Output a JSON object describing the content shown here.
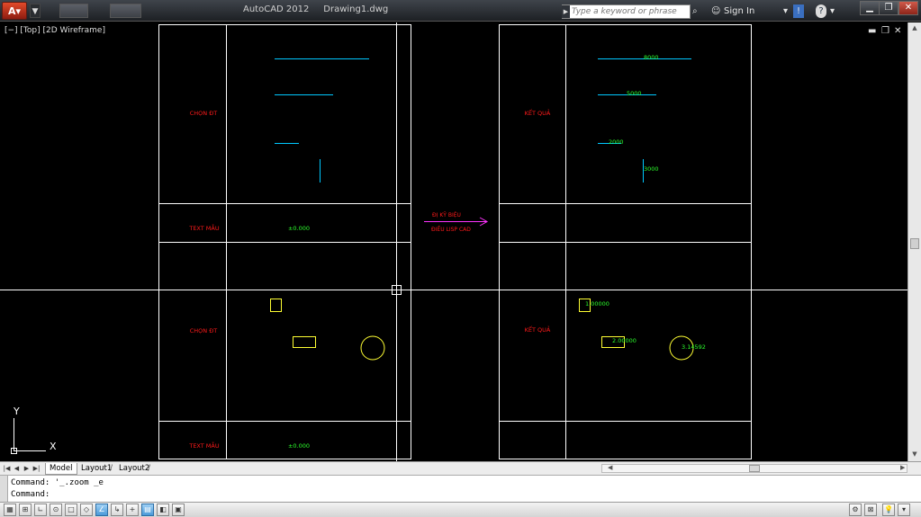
{
  "titlebar": {
    "app_name": "AutoCAD 2012",
    "document": "Drawing1.dwg",
    "search_placeholder": "Type a keyword or phrase",
    "sign_in": "Sign In"
  },
  "viewport": {
    "label": "[−] [Top] [2D Wireframe]"
  },
  "drawing": {
    "colors": {
      "frame": "#ffffff",
      "line": "#00c8ff",
      "red_text": "#ff1a1a",
      "green_text": "#2cff2c",
      "yellow_shape": "#ffff33",
      "arrow": "#ff33ff",
      "crosshair": "#ffffff"
    },
    "left_table": {
      "row1_label": "CHỌN ĐT",
      "row2_label": "TEXT MẪU",
      "row2_value": "±0.000",
      "row4_label": "CHỌN ĐT",
      "row5_label": "TEXT MẪU",
      "row5_value": "±0.000"
    },
    "arrow_caption": {
      "line1": "ĐỊ KỸ BIỆU",
      "line2": "ĐIỀU LISP CAD"
    },
    "right_table": {
      "row1_label": "KẾT QUẢ",
      "dim_8000": "8000",
      "dim_5000": "5000",
      "dim_2000": "2000",
      "dim_3000": "3000",
      "row4_label": "KẾT QUẢ",
      "area_small": "1.00000",
      "area_rect": "2.00000",
      "area_circle": "3.14592"
    },
    "ucs": {
      "x_label": "X",
      "y_label": "Y"
    }
  },
  "tabs": {
    "model": "Model",
    "layout1": "Layout1",
    "layout2": "Layout2"
  },
  "command": {
    "line1": "Command: '_.zoom _e",
    "line2": "Command:"
  }
}
